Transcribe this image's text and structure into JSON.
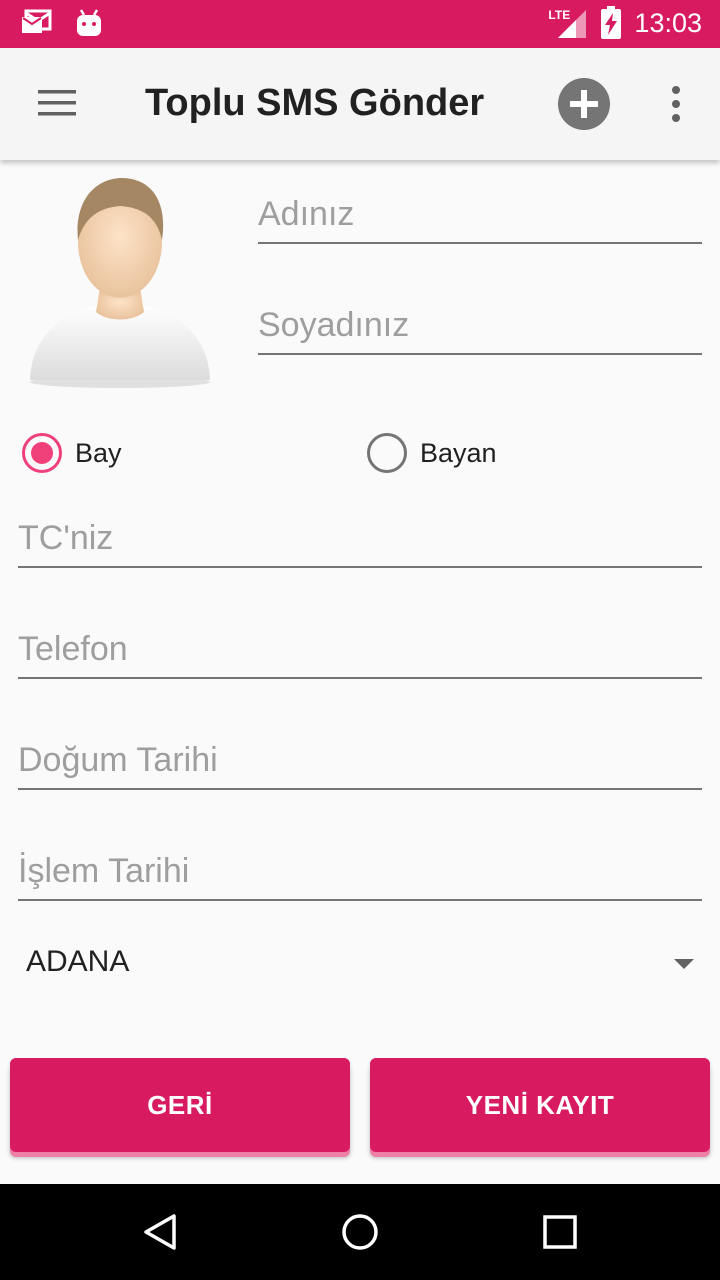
{
  "status_bar": {
    "time": "13:03",
    "network": "LTE",
    "icons": [
      "mail-notification-icon",
      "android-debug-icon",
      "lte-signal-icon",
      "battery-charging-icon"
    ]
  },
  "app_bar": {
    "title": "Toplu SMS Gönder",
    "icons": [
      "menu-icon",
      "add-circle-icon",
      "more-vert-icon"
    ]
  },
  "form": {
    "first_name_hint": "Adınız",
    "last_name_hint": "Soyadınız",
    "gender": {
      "options": [
        {
          "label": "Bay",
          "checked": true
        },
        {
          "label": "Bayan",
          "checked": false
        }
      ]
    },
    "tc_hint": "TC'niz",
    "phone_hint": "Telefon",
    "birth_date_hint": "Doğum Tarihi",
    "process_date_hint": "İşlem Tarihi",
    "city_selected": "ADANA"
  },
  "buttons": {
    "back_label": "GERİ",
    "new_record_label": "YENİ KAYIT"
  },
  "colors": {
    "primary": "#d81b60",
    "radio_accent": "#f0407a",
    "app_bar_bg": "#f5f5f5",
    "hint_text": "#9e9e9e"
  },
  "nav_bar": {
    "icons": [
      "back-triangle-icon",
      "home-circle-icon",
      "recents-square-icon"
    ]
  }
}
